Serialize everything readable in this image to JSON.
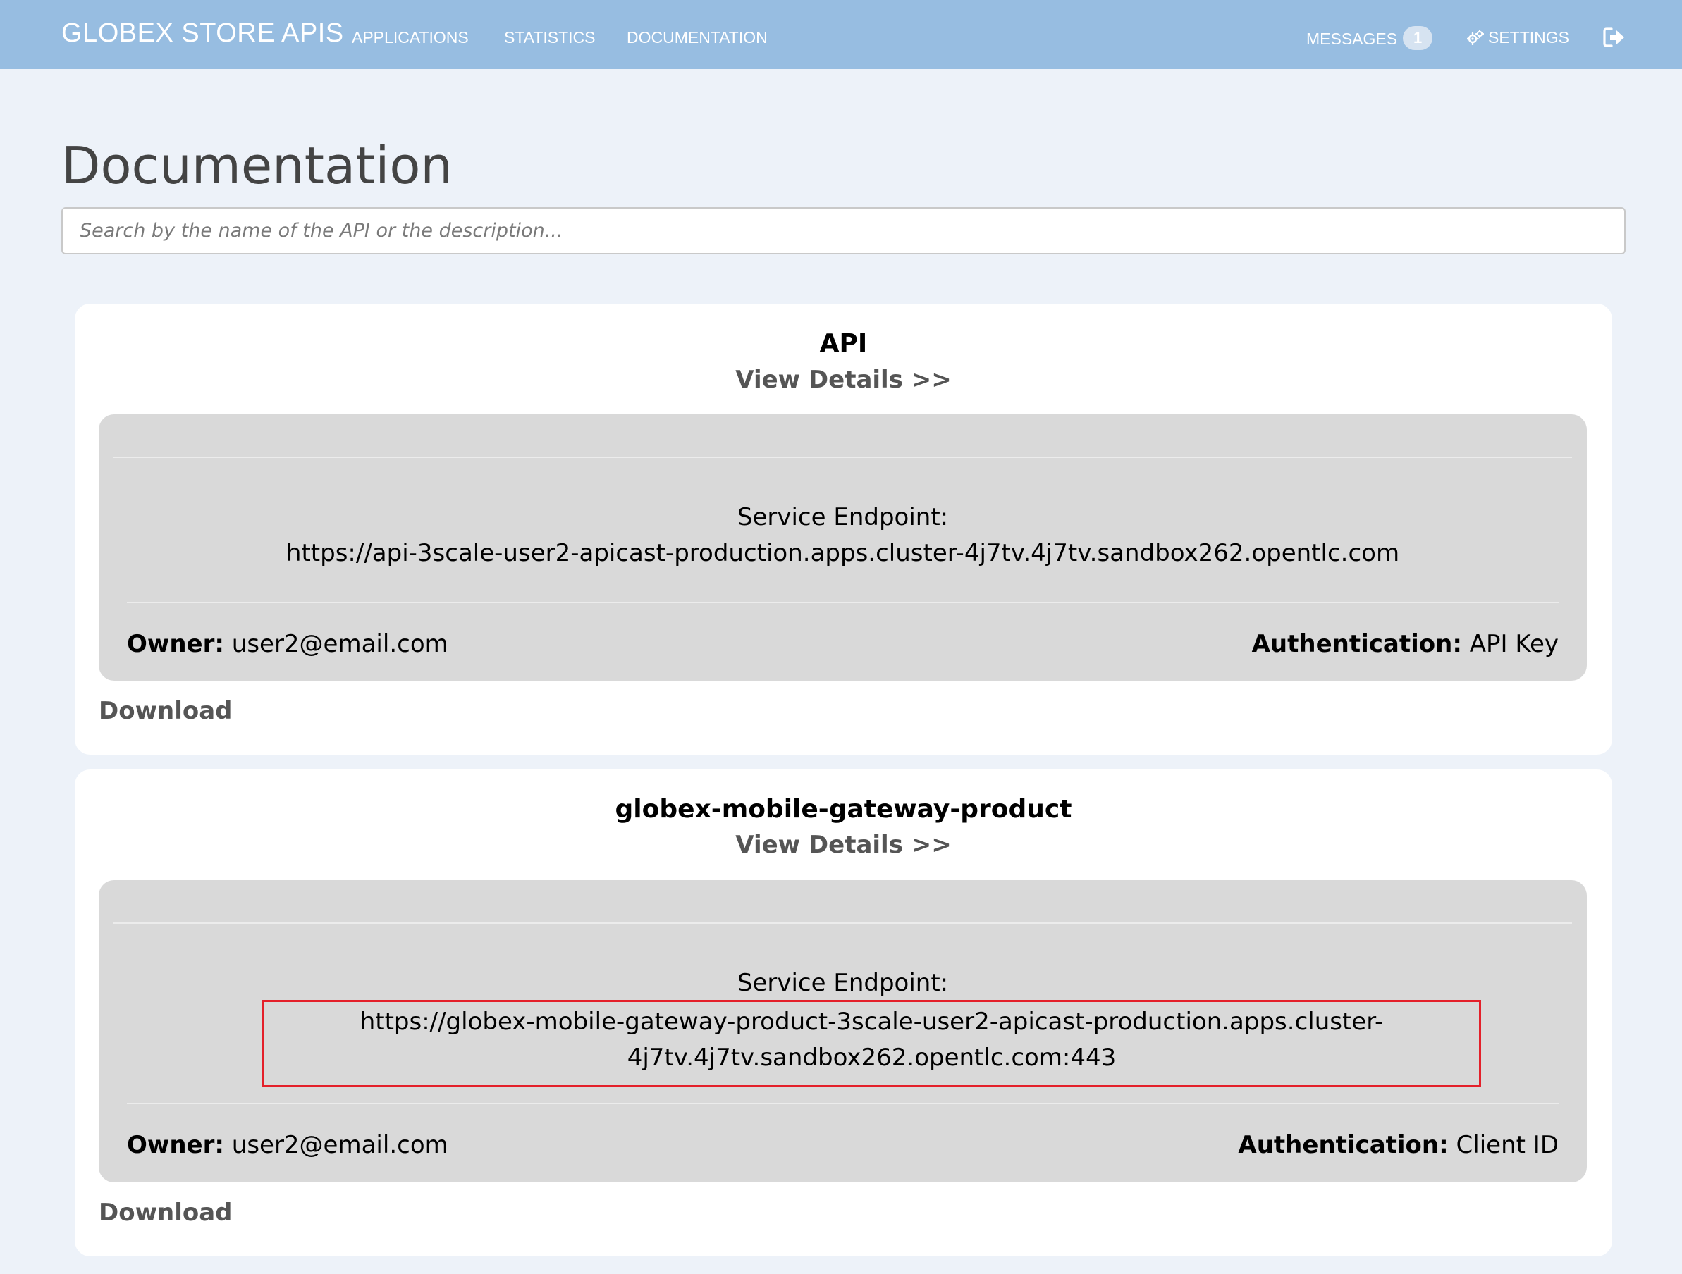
{
  "navbar": {
    "brand": "GLOBEX STORE APIS",
    "links": {
      "applications": "APPLICATIONS",
      "statistics": "STATISTICS",
      "documentation": "DOCUMENTATION",
      "messages": "MESSAGES",
      "settings": "SETTINGS"
    },
    "messages_count": "1",
    "settings_icon": "gears-icon",
    "logout_icon": "sign-out-icon"
  },
  "page": {
    "title": "Documentation",
    "search_placeholder": "Search by the name of the API or the description..."
  },
  "apis": [
    {
      "name": "API",
      "view_details": "View Details >>",
      "endpoint_label": "Service Endpoint:",
      "endpoint_url": "https://api-3scale-user2-apicast-production.apps.cluster-4j7tv.4j7tv.sandbox262.opentlc.com",
      "owner_label": "Owner:",
      "owner": "user2@email.com",
      "auth_label": "Authentication:",
      "auth": "API Key",
      "download": "Download"
    },
    {
      "name": "globex-mobile-gateway-product",
      "view_details": "View Details >>",
      "endpoint_label": "Service Endpoint:",
      "endpoint_url_line1": "https://globex-mobile-gateway-product-3scale-user2-apicast-production.apps.cluster-",
      "endpoint_url_line2": "4j7tv.4j7tv.sandbox262.opentlc.com:443",
      "owner_label": "Owner:",
      "owner": "user2@email.com",
      "auth_label": "Authentication:",
      "auth": "Client ID",
      "download": "Download"
    }
  ],
  "colors": {
    "navbar": "#97bde1",
    "page_background": "#edf2f9",
    "panel": "#d9d9d9",
    "highlight_box": "#e4202a"
  }
}
